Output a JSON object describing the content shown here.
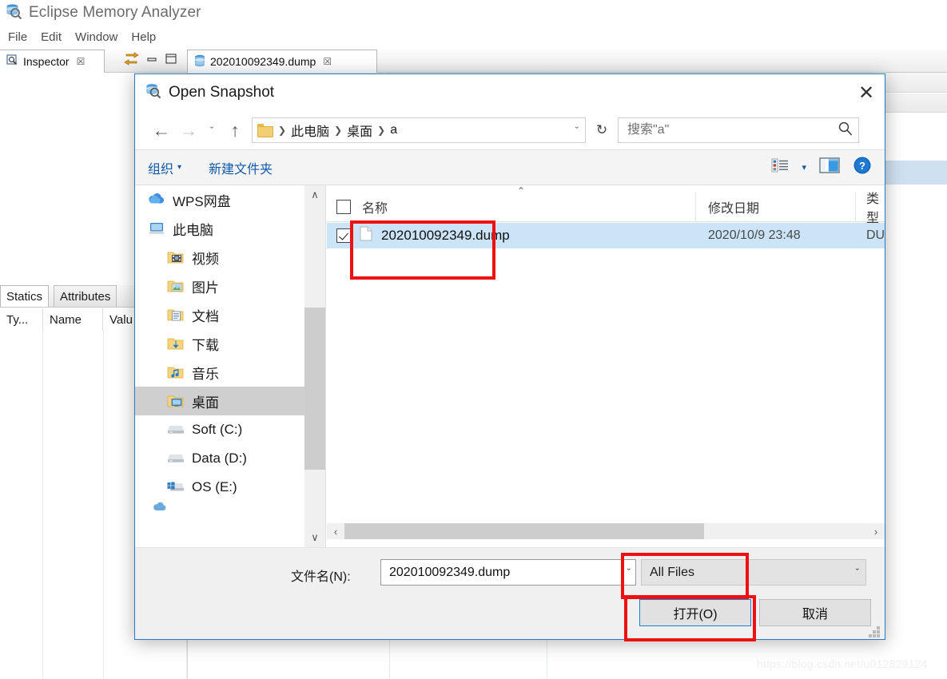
{
  "app": {
    "title": "Eclipse Memory Analyzer",
    "icon": "memory-analyzer-icon",
    "menu": [
      "File",
      "Edit",
      "Window",
      "Help"
    ],
    "tabs": [
      {
        "label": "Inspector",
        "icon": "inspector-icon",
        "close": "☒"
      },
      {
        "label": "202010092349.dump",
        "icon": "heap-dump-icon",
        "close": "☒"
      }
    ],
    "view_controls": {
      "link_icon": "link-editor-icon",
      "minimize": "▬",
      "maximize": "❐"
    },
    "inspector": {
      "tabs": [
        "Statics",
        "Attributes"
      ],
      "columns": [
        "Ty...",
        "Name",
        "Valu"
      ]
    }
  },
  "dialog": {
    "title": "Open Snapshot",
    "icon": "open-snapshot-icon",
    "close_label": "✕",
    "nav": {
      "back": "←",
      "forward": "→",
      "recent": "ˇ",
      "up": "↑",
      "refresh": "↻",
      "breadcrumb": [
        "此电脑",
        "桌面",
        "a"
      ],
      "breadcrumb_sep": "❯",
      "breadcrumb_caret": "ˇ",
      "folder_icon": "folder-icon"
    },
    "search": {
      "placeholder": "搜索\"a\"",
      "value": "",
      "icon": "search-icon"
    },
    "commandbar": {
      "organize": "组织",
      "organize_caret": "▾",
      "new_folder": "新建文件夹",
      "view_icon": "view-list-icon",
      "view_caret": "▾",
      "pane_icon": "preview-pane-icon",
      "help_icon": "help-icon"
    },
    "tree": [
      {
        "label": "WPS网盘",
        "icon": "cloud-icon",
        "indent": false,
        "selected": false
      },
      {
        "label": "此电脑",
        "icon": "this-pc-icon",
        "indent": false,
        "selected": false
      },
      {
        "label": "视频",
        "icon": "folder-videos-icon",
        "indent": true,
        "selected": false
      },
      {
        "label": "图片",
        "icon": "folder-pictures-icon",
        "indent": true,
        "selected": false
      },
      {
        "label": "文档",
        "icon": "folder-documents-icon",
        "indent": true,
        "selected": false
      },
      {
        "label": "下载",
        "icon": "folder-downloads-icon",
        "indent": true,
        "selected": false
      },
      {
        "label": "音乐",
        "icon": "folder-music-icon",
        "indent": true,
        "selected": false
      },
      {
        "label": "桌面",
        "icon": "folder-desktop-icon",
        "indent": true,
        "selected": true
      },
      {
        "label": "Soft (C:)",
        "icon": "drive-icon",
        "indent": true,
        "selected": false
      },
      {
        "label": "Data (D:)",
        "icon": "drive-icon",
        "indent": true,
        "selected": false
      },
      {
        "label": "OS (E:)",
        "icon": "windows-drive-icon",
        "indent": true,
        "selected": false
      }
    ],
    "tree_scroll": {
      "up": "∧",
      "down": "∨"
    },
    "filelist": {
      "columns": [
        "名称",
        "修改日期",
        "类型"
      ],
      "sort_indicator": "⌃",
      "rows": [
        {
          "name": "202010092349.dump",
          "modified": "2020/10/9 23:48",
          "type": "DU",
          "checked": true,
          "selected": true,
          "icon": "file-icon"
        }
      ],
      "hscroll": {
        "left": "‹",
        "right": "›"
      }
    },
    "footer": {
      "filename_label": "文件名(N):",
      "filename_value": "202010092349.dump",
      "filename_caret": "ˇ",
      "filter_value": "All Files",
      "filter_caret": "ˇ",
      "open_button": "打开(O)",
      "cancel_button": "取消"
    }
  },
  "annotations": {
    "highlight_color": "#ee1111",
    "boxes": [
      "file-row-highlight",
      "file-type-filter-highlight",
      "open-button-highlight"
    ]
  },
  "watermark": "https://blog.csdn.net/u012829124"
}
